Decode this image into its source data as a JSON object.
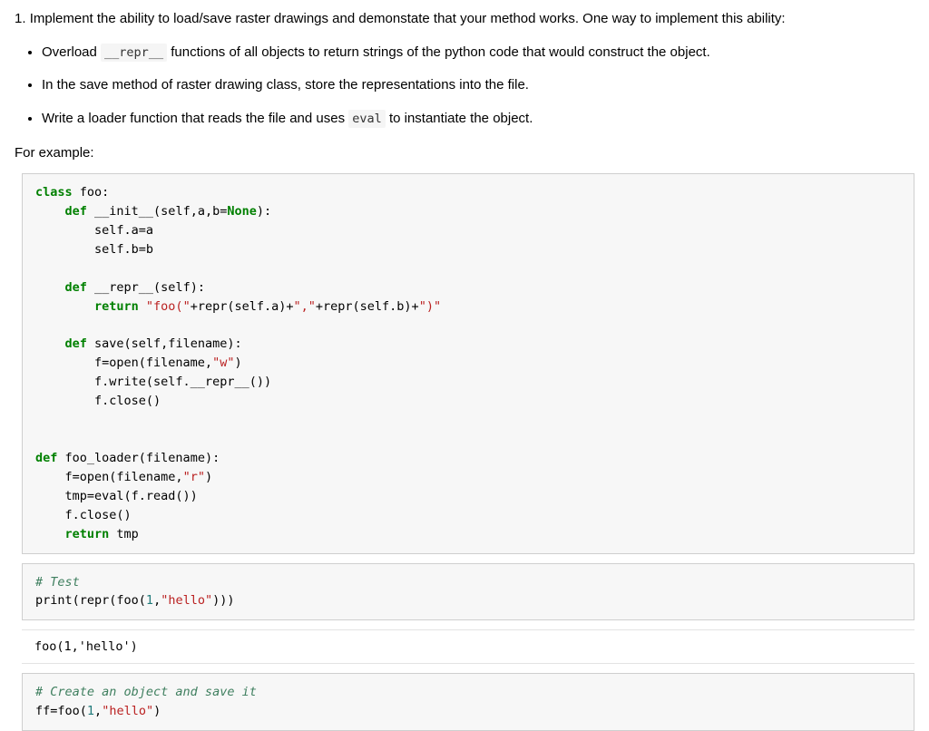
{
  "instruction": {
    "number": "1.",
    "main": "Implement the ability to load/save raster drawings and demonstate that your method works. One way to implement this ability:",
    "bullet1_a": "Overload ",
    "bullet1_code": "__repr__",
    "bullet1_b": " functions of all objects to return strings of the python code that would construct the object.",
    "bullet2": "In the save method of raster drawing class, store the representations into the file.",
    "bullet3_a": "Write a loader function that reads the file and uses ",
    "bullet3_code": "eval",
    "bullet3_b": " to instantiate the object.",
    "for_example": "For example:"
  },
  "cell1": {
    "l1_kw": "class",
    "l1_name": " foo:",
    "l2_kw": "    def",
    "l2_name": " __init__(self,a,b=",
    "l2_none": "None",
    "l2_end": "):",
    "l3": "        self.a=a",
    "l4": "        self.b=b",
    "blank": "",
    "l5_kw": "    def",
    "l5_name": " __repr__(self):",
    "l6_kw": "        return",
    "l6_s1": " \"foo(\"",
    "l6_p1": "+repr(self.a)+",
    "l6_s2": "\",\"",
    "l6_p2": "+repr(self.b)+",
    "l6_s3": "\")\"",
    "l7_kw": "    def",
    "l7_name": " save(self,filename):",
    "l8_a": "        f=open(filename,",
    "l8_s": "\"w\"",
    "l8_b": ")",
    "l9": "        f.write(self.__repr__())",
    "l10": "        f.close()",
    "l11_kw": "def",
    "l11_name": " foo_loader(filename):",
    "l12_a": "    f=open(filename,",
    "l12_s": "\"r\"",
    "l12_b": ")",
    "l13": "    tmp=eval(f.read())",
    "l14": "    f.close()",
    "l15_kw": "    return",
    "l15_rest": " tmp"
  },
  "cell2": {
    "comment": "# Test",
    "l1_a": "print(repr(foo(",
    "l1_n": "1",
    "l1_b": ",",
    "l1_s": "\"hello\"",
    "l1_c": ")))"
  },
  "output1": "foo(1,'hello')",
  "cell3": {
    "comment": "# Create an object and save it",
    "l1_a": "ff=foo(",
    "l1_n": "1",
    "l1_b": ",",
    "l1_s": "\"hello\"",
    "l1_c": ")"
  }
}
